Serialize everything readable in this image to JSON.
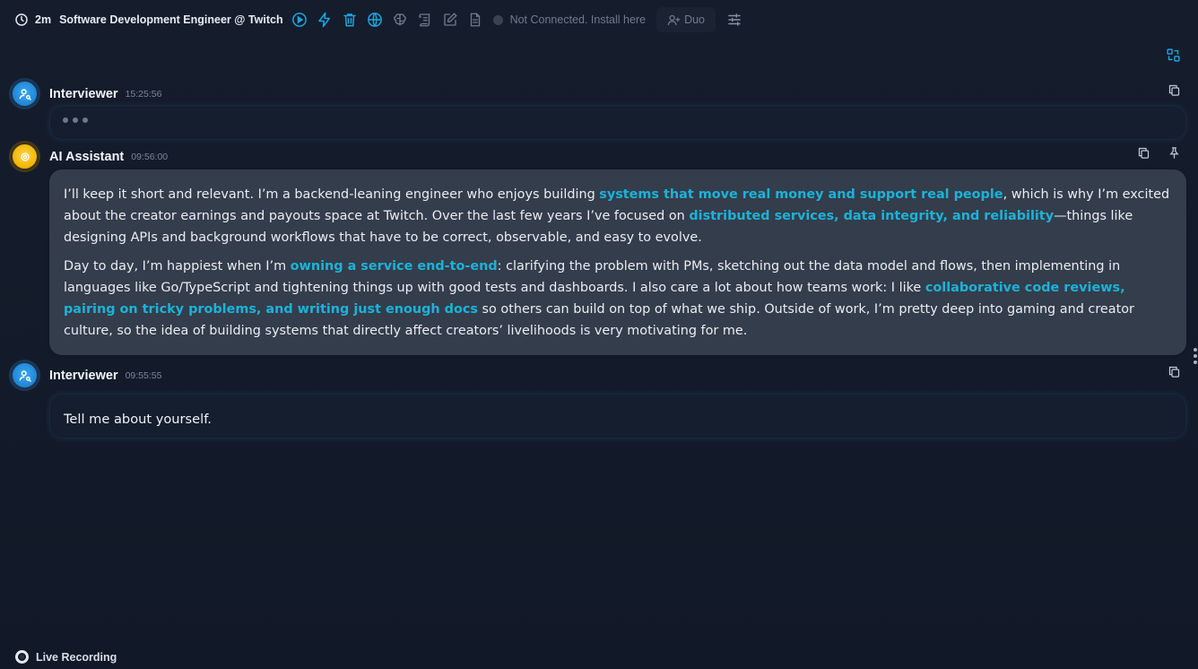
{
  "toolbar": {
    "elapsed": "2m",
    "title": "Software Development Engineer @ Twitch",
    "icons": [
      "play-circle-icon",
      "lightning-icon",
      "trash-icon",
      "globe-icon",
      "brain-icon",
      "scroll-icon",
      "edit-icon",
      "document-icon"
    ],
    "status_text": "Not Connected. Install here",
    "duo_label": "Duo",
    "accent_color": "#1fa3e0"
  },
  "messages": [
    {
      "sender": "Interviewer",
      "time": "15:25:56",
      "state": "typing"
    },
    {
      "sender": "AI Assistant",
      "time": "09:56:00",
      "paragraphs": [
        [
          {
            "t": "I’ll keep it short and relevant. I’m a backend-leaning engineer who enjoys building "
          },
          {
            "t": "systems that move real money and support real people",
            "hl": true
          },
          {
            "t": ", which is why I’m excited about the creator earnings and payouts space at Twitch. Over the last few years I’ve focused on "
          },
          {
            "t": "distributed services, data integrity, and reliability",
            "hl": true
          },
          {
            "t": "—things like designing APIs and background workflows that have to be correct, observable, and easy to evolve."
          }
        ],
        [
          {
            "t": "Day to day, I’m happiest when I’m "
          },
          {
            "t": "owning a service end-to-end",
            "hl": true
          },
          {
            "t": ": clarifying the problem with PMs, sketching out the data model and flows, then implementing in languages like Go/TypeScript and tightening things up with good tests and dashboards. I also care a lot about how teams work: I like "
          },
          {
            "t": "collaborative code reviews, pairing on tricky problems, and writing just enough docs",
            "hl": true
          },
          {
            "t": " so others can build on top of what we ship. Outside of work, I’m pretty deep into gaming and creator culture, so the idea of building systems that directly affect creators’ livelihoods is very motivating for me."
          }
        ]
      ]
    },
    {
      "sender": "Interviewer",
      "time": "09:55:55",
      "text": "Tell me about yourself."
    }
  ],
  "footer": {
    "live_label": "Live Recording"
  }
}
